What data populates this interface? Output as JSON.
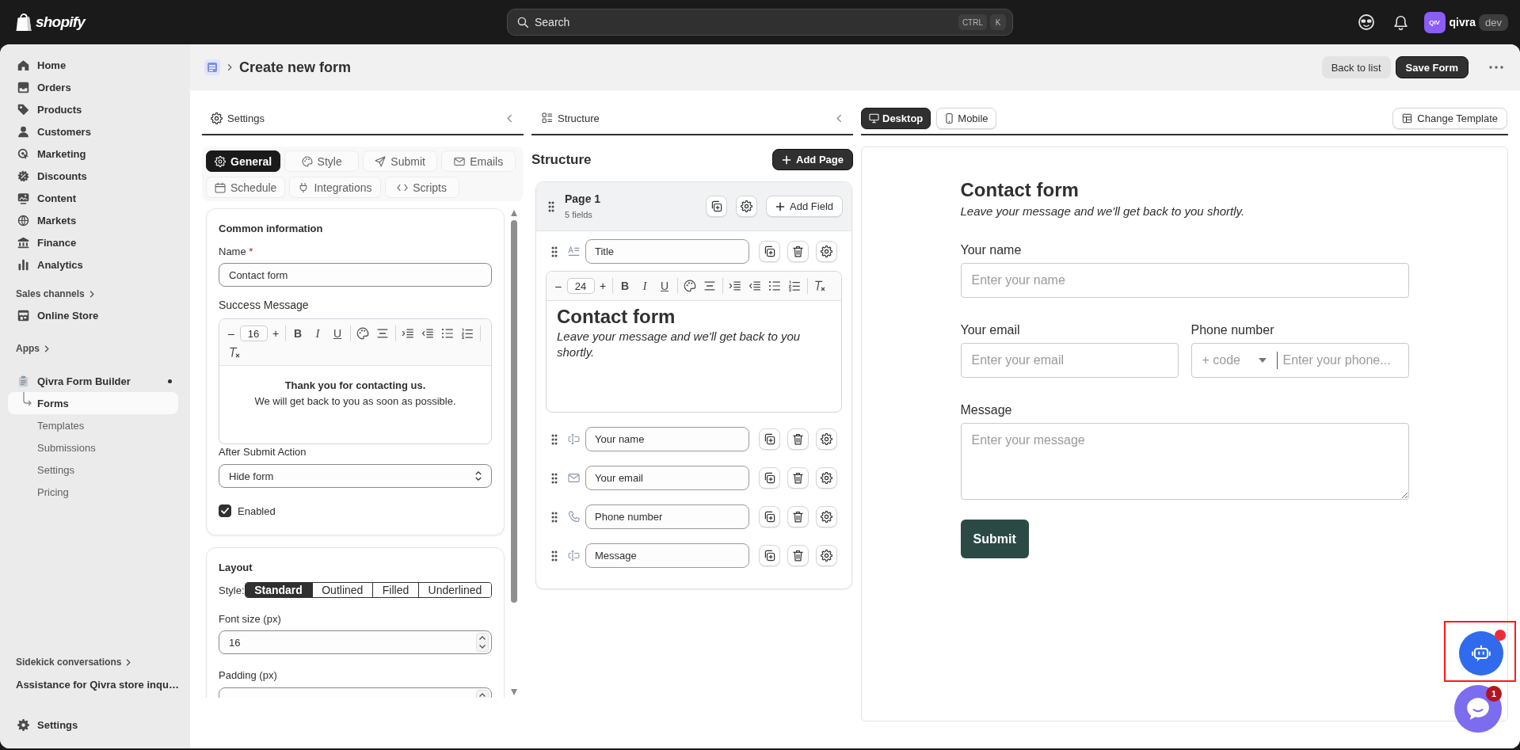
{
  "top_bar": {
    "logo": "shopify",
    "search": {
      "placeholder": "Search",
      "keys": [
        "CTRL",
        "K"
      ]
    },
    "store": {
      "initials": "QIV",
      "name": "qivra",
      "badge": "dev"
    }
  },
  "sidebar": {
    "items": [
      {
        "label": "Home",
        "selected": false
      },
      {
        "label": "Orders",
        "selected": false
      },
      {
        "label": "Products",
        "selected": false
      },
      {
        "label": "Customers",
        "selected": false
      },
      {
        "label": "Marketing",
        "selected": false
      },
      {
        "label": "Discounts",
        "selected": false
      },
      {
        "label": "Content",
        "selected": false
      },
      {
        "label": "Markets",
        "selected": false
      },
      {
        "label": "Finance",
        "selected": false
      },
      {
        "label": "Analytics",
        "selected": false
      }
    ],
    "sections": [
      {
        "heading": "Sales channels",
        "items": [
          {
            "label": "Online Store",
            "selected": false
          }
        ]
      },
      {
        "heading": "Apps",
        "items": [
          {
            "label": "Qivra Form Builder",
            "selected": false,
            "children": [
              {
                "label": "Forms",
                "selected": true
              },
              {
                "label": "Templates",
                "selected": false
              },
              {
                "label": "Submissions",
                "selected": false
              },
              {
                "label": "Settings",
                "selected": false
              },
              {
                "label": "Pricing",
                "selected": false
              }
            ]
          }
        ]
      }
    ],
    "conversations": {
      "heading": "Sidekick conversations",
      "items": [
        {
          "label": "Assistance for Qivra store inqu…",
          "selected": false
        }
      ]
    },
    "footer": {
      "label": "Settings"
    }
  },
  "header": {
    "title": "Create new form",
    "actions": [
      {
        "label": "Back to list",
        "kind": "secondary"
      },
      {
        "label": "Save Form",
        "kind": "primary"
      }
    ]
  },
  "settings_panel": {
    "title": "Settings",
    "tabs": [
      {
        "label": "General",
        "selected": true
      },
      {
        "label": "Style",
        "selected": false
      },
      {
        "label": "Submit",
        "selected": false
      },
      {
        "label": "Emails",
        "selected": false
      },
      {
        "label": "Schedule",
        "selected": false
      },
      {
        "label": "Integrations",
        "selected": false
      },
      {
        "label": "Scripts",
        "selected": false
      }
    ],
    "common": {
      "heading": "Common information",
      "name": {
        "label": "Name",
        "required_mark": "*",
        "value": "Contact form"
      },
      "success_message": {
        "label": "Success Message",
        "toolbar": {
          "decrease": "–",
          "font_size": "16",
          "increase": "+",
          "formats": [
            {
              "label": "B",
              "kind": "bold"
            },
            {
              "label": "I",
              "kind": "italic"
            },
            {
              "label": "U",
              "kind": "underline"
            }
          ]
        },
        "lines": [
          {
            "text": "Thank you for contacting us.",
            "bold": true
          },
          {
            "text": "We will get back to you as soon as possible.",
            "bold": false
          }
        ]
      },
      "after_submit": {
        "label": "After Submit Action",
        "value": "Hide form"
      },
      "enabled": {
        "label": "Enabled",
        "checked": true
      }
    },
    "layout": {
      "heading": "Layout",
      "style": {
        "label": "Style:",
        "options": [
          {
            "label": "Standard",
            "selected": true
          },
          {
            "label": "Outlined",
            "selected": false
          },
          {
            "label": "Filled",
            "selected": false
          },
          {
            "label": "Underlined",
            "selected": false
          }
        ]
      },
      "font_size": {
        "label": "Font size (px)",
        "value": "16"
      },
      "padding": {
        "label": "Padding (px)"
      }
    }
  },
  "structure_panel": {
    "title": "Structure",
    "heading": "Structure",
    "add_page": "Add Page",
    "pages": [
      {
        "title": "Page 1",
        "count": "5 fields",
        "add_field": "Add Field",
        "fields": [
          {
            "kind": "heading",
            "label": "Title",
            "editor": {
              "toolbar": {
                "decrease": "–",
                "font_size": "24",
                "increase": "+",
                "formats": [
                  {
                    "label": "B",
                    "kind": "bold"
                  },
                  {
                    "label": "I",
                    "kind": "italic"
                  },
                  {
                    "label": "U",
                    "kind": "underline"
                  }
                ]
              },
              "heading": "Contact form",
              "text": "Leave your message and we'll get back to you shortly."
            }
          },
          {
            "kind": "text",
            "label": "Your name"
          },
          {
            "kind": "email",
            "label": "Your email"
          },
          {
            "kind": "phone",
            "label": "Phone number"
          },
          {
            "kind": "text",
            "label": "Message"
          }
        ]
      }
    ]
  },
  "preview": {
    "tabs": [
      {
        "label": "Desktop",
        "selected": true
      },
      {
        "label": "Mobile",
        "selected": false
      }
    ],
    "change_template": "Change Template",
    "form": {
      "title": "Contact form",
      "subtitle": "Leave your message and we'll get back to you shortly.",
      "rows": [
        [
          {
            "kind": "text",
            "label": "Your name",
            "placeholder": "Enter your name"
          }
        ],
        [
          {
            "kind": "email",
            "label": "Your email",
            "placeholder": "Enter your email"
          },
          {
            "kind": "phone",
            "label": "Phone number",
            "code": "+ code",
            "placeholder": "Enter your phone..."
          }
        ],
        [
          {
            "kind": "textarea",
            "label": "Message",
            "placeholder": "Enter your message"
          }
        ]
      ],
      "submit": "Submit"
    }
  },
  "assistant": {
    "unread": true,
    "highlighted": true
  },
  "chat": {
    "badge": "1"
  }
}
